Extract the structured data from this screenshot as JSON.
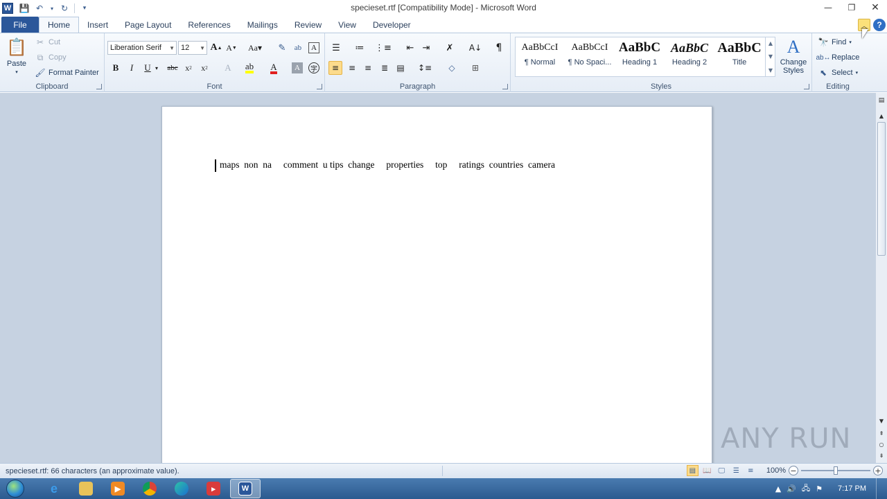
{
  "window": {
    "title": "specieset.rtf [Compatibility Mode]  -  Microsoft Word",
    "app_logo": "W"
  },
  "tabs": [
    "File",
    "Home",
    "Insert",
    "Page Layout",
    "References",
    "Mailings",
    "Review",
    "View",
    "Developer"
  ],
  "active_tab": "Home",
  "clipboard": {
    "label": "Clipboard",
    "paste": "Paste",
    "cut": "Cut",
    "copy": "Copy",
    "format_painter": "Format Painter"
  },
  "font": {
    "label": "Font",
    "family": "Liberation Serif",
    "size": "12"
  },
  "paragraph": {
    "label": "Paragraph"
  },
  "styles": {
    "label": "Styles",
    "items": [
      {
        "preview": "AaBbCcI",
        "name": "¶ Normal"
      },
      {
        "preview": "AaBbCcI",
        "name": "¶ No Spaci..."
      },
      {
        "preview": "AaBbC",
        "name": "Heading 1"
      },
      {
        "preview": "AaBbC",
        "name": "Heading 2"
      },
      {
        "preview": "AaBbC",
        "name": "Title"
      }
    ],
    "change_styles_line1": "Change",
    "change_styles_line2": "Styles"
  },
  "editing": {
    "label": "Editing",
    "find": "Find",
    "replace": "Replace",
    "select": "Select"
  },
  "document": {
    "text": "maps  non  na     comment  u tips  change     properties     top     ratings  countries  camera"
  },
  "status": {
    "text": "specieset.rtf: 66 characters (an approximate value).",
    "zoom": "100%",
    "zoom_level": 0.5
  },
  "watermark": "ANY RUN",
  "taskbar": {
    "clock": "7:17 PM"
  }
}
